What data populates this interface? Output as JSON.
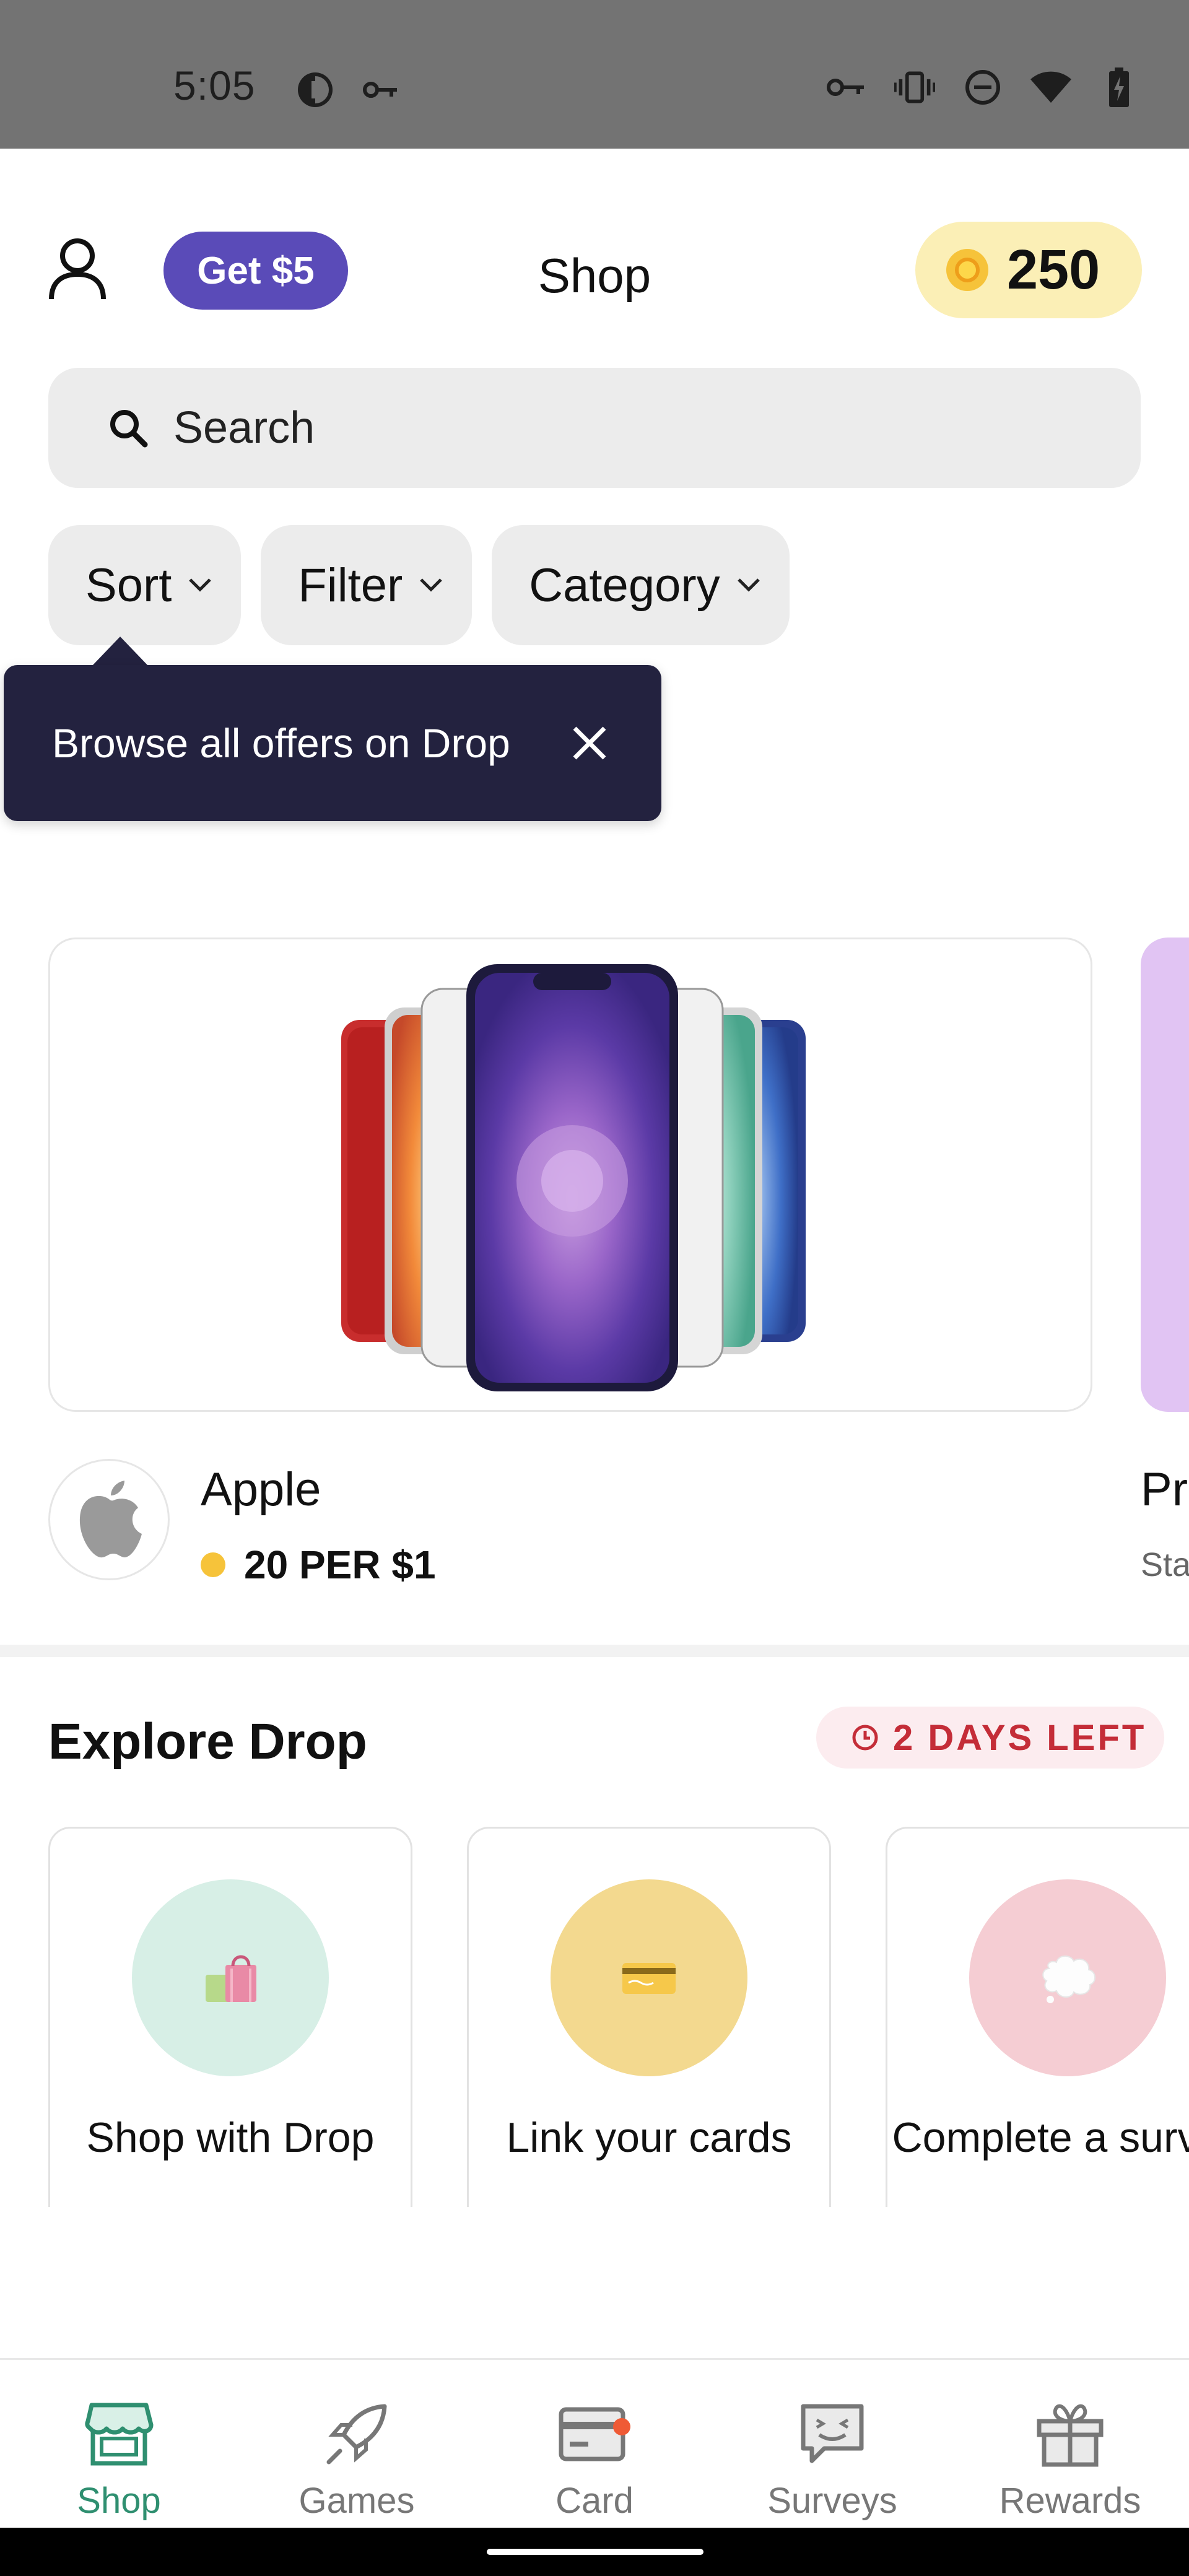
{
  "status_bar": {
    "time": "5:05",
    "left_icons": [
      "data-saver-icon",
      "vpn-key-icon"
    ],
    "right_icons": [
      "vpn-key-icon",
      "vibrate-icon",
      "do-not-disturb-icon",
      "wifi-icon",
      "battery-charging-icon"
    ]
  },
  "header": {
    "profile_icon": "person-outline-icon",
    "get_bonus_label": "Get $5",
    "title": "Shop",
    "points": "250"
  },
  "search": {
    "placeholder": "Search"
  },
  "filters": {
    "sort_label": "Sort",
    "filter_label": "Filter",
    "category_label": "Category"
  },
  "tooltip": {
    "text": "Browse all offers on Drop"
  },
  "offer": {
    "brand": "Apple",
    "rate": "20 PER $1",
    "next_brand": "Pr",
    "next_sub": "Sta"
  },
  "explore": {
    "title": "Explore Drop",
    "days_left": "2 DAYS LEFT",
    "cards": [
      {
        "label": "Shop with Drop",
        "icon": "shopping-bags-icon",
        "color": "#d7efe6"
      },
      {
        "label": "Link your cards",
        "icon": "credit-card-icon",
        "color": "#f3d98f"
      },
      {
        "label": "Complete a survey",
        "icon": "speech-bubble-icon",
        "color": "#f5cdd3"
      }
    ]
  },
  "bottom_nav": {
    "items": [
      {
        "label": "Shop",
        "icon": "storefront-icon",
        "active": true
      },
      {
        "label": "Games",
        "icon": "rocket-icon",
        "active": false
      },
      {
        "label": "Card",
        "icon": "card-icon",
        "active": false
      },
      {
        "label": "Surveys",
        "icon": "chat-smile-icon",
        "active": false
      },
      {
        "label": "Rewards",
        "icon": "gift-icon",
        "active": false
      }
    ]
  },
  "colors": {
    "accent_purple": "#5a4bb8",
    "active_green": "#2f8f70",
    "tooltip_bg": "#23223f",
    "points_bg": "#fbefb6",
    "deadline_red": "#c42d38"
  }
}
